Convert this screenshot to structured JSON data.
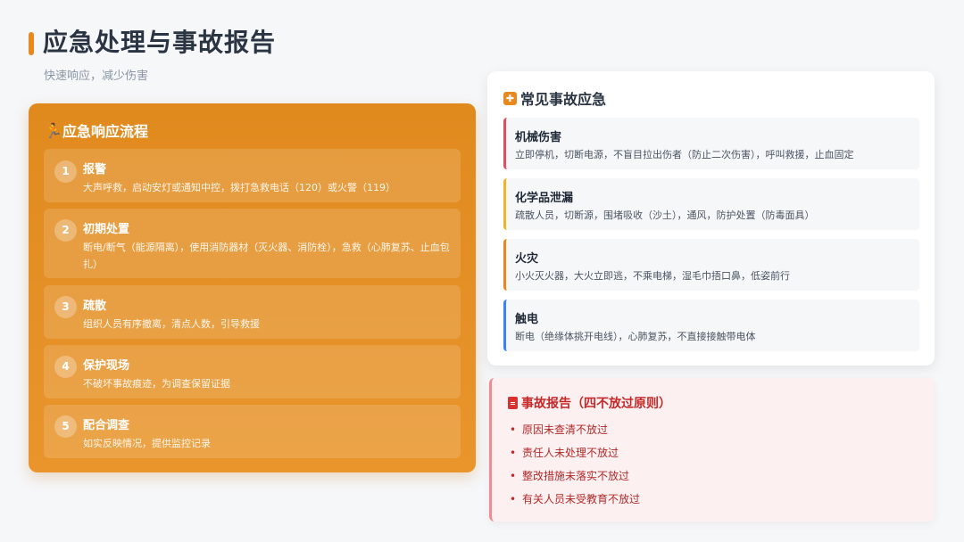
{
  "header": {
    "title": "应急处理与事故报告",
    "subtitle": "快速响应，减少伤害"
  },
  "flow": {
    "title": "应急响应流程",
    "icon": "running-person-icon",
    "steps": [
      {
        "num": "1",
        "title": "报警",
        "desc": "大声呼救，启动安灯或通知中控，拨打急救电话（120）或火警（119）"
      },
      {
        "num": "2",
        "title": "初期处置",
        "desc": "断电/断气（能源隔离），使用消防器材（灭火器、消防栓），急救（心肺复苏、止血包扎）"
      },
      {
        "num": "3",
        "title": "疏散",
        "desc": "组织人员有序撤离，清点人数，引导救援"
      },
      {
        "num": "4",
        "title": "保护现场",
        "desc": "不破坏事故痕迹，为调查保留证据"
      },
      {
        "num": "5",
        "title": "配合调查",
        "desc": "如实反映情况，提供监控记录"
      }
    ]
  },
  "accidents": {
    "title": "常见事故应急",
    "icon": "first-aid-kit-icon",
    "items": [
      {
        "name": "机械伤害",
        "desc": "立即停机，切断电源，不盲目拉出伤者（防止二次伤害），呼叫救援，止血固定",
        "color": "#e04f5f"
      },
      {
        "name": "化学品泄漏",
        "desc": "疏散人员，切断源，围堵吸收（沙土），通风，防护处置（防毒面具）",
        "color": "#f0b429"
      },
      {
        "name": "火灾",
        "desc": "小火灭火器，大火立即逃，不乘电梯，湿毛巾捂口鼻，低姿前行",
        "color": "#e8891e"
      },
      {
        "name": "触电",
        "desc": "断电（绝缘体挑开电线），心肺复苏，不直接接触带电体",
        "color": "#3b82f6"
      }
    ]
  },
  "report": {
    "title": "事故报告（四不放过原则）",
    "icon": "document-icon",
    "items": [
      "原因未查清不放过",
      "责任人未处理不放过",
      "整改措施未落实不放过",
      "有关人员未受教育不放过"
    ]
  }
}
